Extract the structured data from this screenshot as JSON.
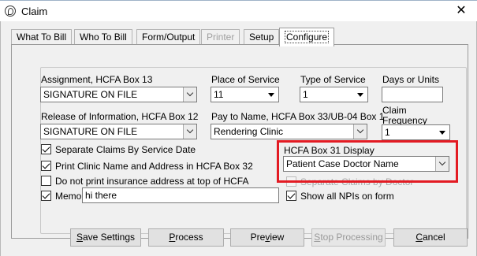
{
  "window": {
    "title": "Claim"
  },
  "tabs": [
    {
      "label": "What To Bill"
    },
    {
      "label": "Who To Bill"
    },
    {
      "label": "Form/Output"
    },
    {
      "label": "Printer",
      "disabled": true
    },
    {
      "label": "Setup"
    },
    {
      "label": "Configure",
      "active": true
    }
  ],
  "form": {
    "assignment": {
      "label": "Assignment,  HCFA Box 13",
      "value": "SIGNATURE ON FILE"
    },
    "place_of_service": {
      "label": "Place of Service",
      "value": "11"
    },
    "type_of_service": {
      "label": "Type of Service",
      "value": "1"
    },
    "days_or_units": {
      "label": "Days or Units",
      "value": ""
    },
    "release_info": {
      "label": "Release of Information, HCFA Box 12",
      "value": "SIGNATURE ON FILE"
    },
    "pay_to_name": {
      "label": "Pay to Name,  HCFA Box 33/UB-04 Box 1",
      "value": "Rendering Clinic"
    },
    "claim_frequency": {
      "label_line1": "Claim",
      "label_line2": "Frequency",
      "value": "1"
    },
    "separate_claims_date": {
      "label": "Separate Claims By Service Date",
      "checked": true
    },
    "print_clinic_name": {
      "label": "Print Clinic Name and Address in HCFA Box 32",
      "checked": true
    },
    "no_insurance_address": {
      "label": "Do not print insurance address at top of HCFA",
      "checked": false
    },
    "memo": {
      "label": "Memo:",
      "value": "hi there",
      "checked": true
    },
    "hcfa_box31": {
      "label": "HCFA Box 31 Display",
      "value": "Patient Case Doctor Name"
    },
    "separate_claims_doctor": {
      "label": "Separate Claims by Doctor",
      "checked": false,
      "disabled": true
    },
    "show_all_npis": {
      "label": "Show all NPIs on form",
      "checked": true
    }
  },
  "buttons": {
    "save_settings": {
      "u": "S",
      "rest": "ave Settings"
    },
    "process": {
      "u": "P",
      "rest": "rocess"
    },
    "preview": {
      "pre": "Pre",
      "u": "v",
      "rest": "iew"
    },
    "stop_processing": {
      "u": "S",
      "rest": "top Processing"
    },
    "cancel": {
      "u": "C",
      "rest": "ancel"
    }
  },
  "colors": {
    "highlight": "#e31b23",
    "window_bg": "#f0f0f0",
    "button_bg": "#e1e1e1"
  }
}
